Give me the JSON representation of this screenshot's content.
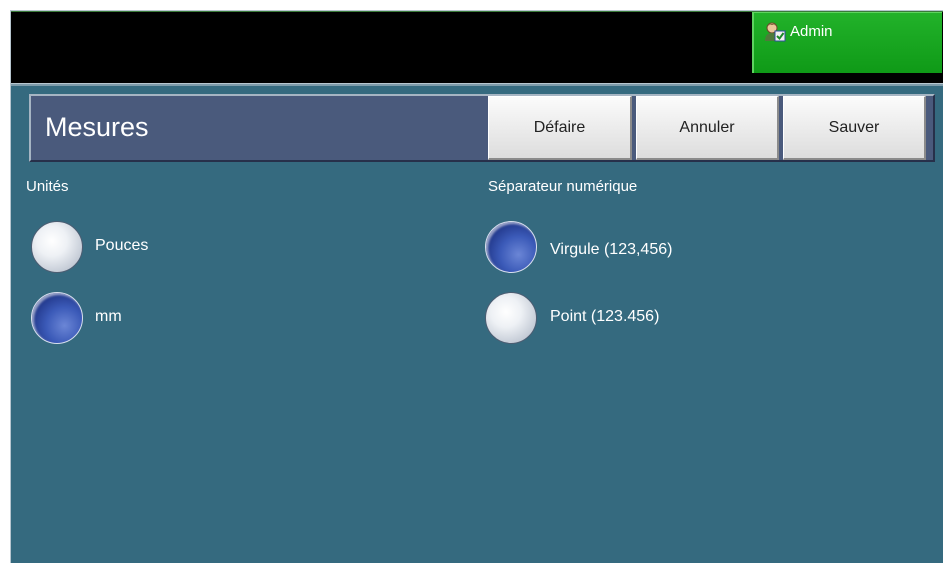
{
  "topbar": {
    "admin_label": "Admin",
    "admin_icon": "admin-user-icon"
  },
  "header": {
    "title": "Mesures",
    "buttons": {
      "undo": "Défaire",
      "cancel": "Annuler",
      "save": "Sauver"
    }
  },
  "units": {
    "label": "Unités",
    "options": [
      {
        "label": "Pouces",
        "selected": false
      },
      {
        "label": "mm",
        "selected": true
      }
    ]
  },
  "separator": {
    "label": "Séparateur numérique",
    "options": [
      {
        "label": "Virgule (123,456)",
        "selected": true
      },
      {
        "label": "Point (123.456)",
        "selected": false
      }
    ]
  },
  "colors": {
    "background": "#356a7f",
    "header_panel": "#4a5a7c",
    "admin_button": "#17a51f",
    "radio_selected": "#2a47a5"
  }
}
